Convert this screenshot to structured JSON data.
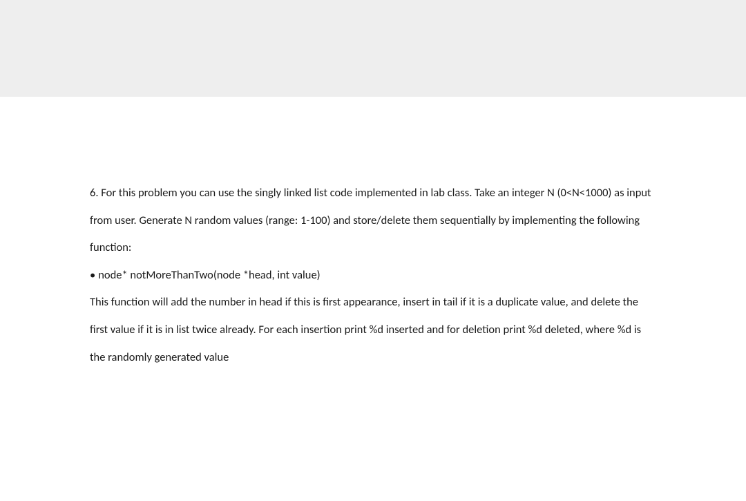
{
  "question": {
    "number": "6.",
    "intro": "For this problem you can use the singly linked list code implemented in lab class. Take an integer N (0<N<1000) as input from user. Generate N random values (range: 1-100) and store/delete them sequentially by implementing the following function:",
    "bullet_symbol": "•",
    "function_signature": "node* notMoreThanTwo(node *head, int value)",
    "description": "This function will add the number in head if this is first appearance, insert in tail if it is a duplicate value, and delete the first value if it is in list twice already. For each insertion print %d inserted and for deletion print %d deleted, where %d is the randomly generated value"
  }
}
